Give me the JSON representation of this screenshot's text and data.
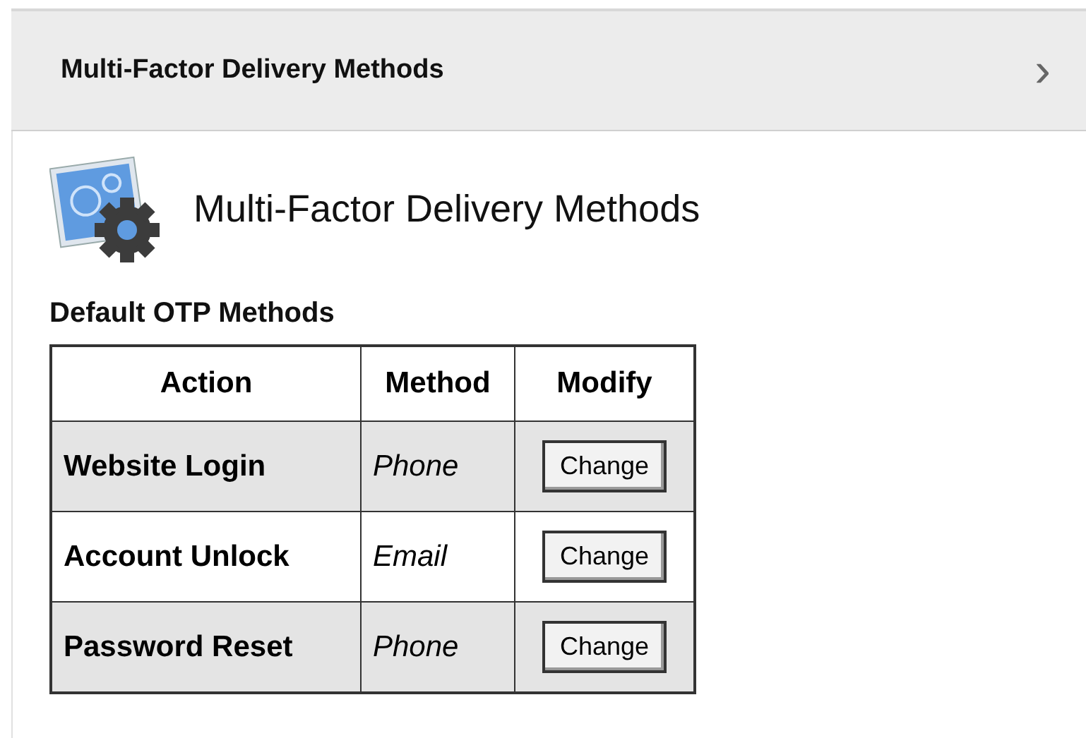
{
  "panel_header": {
    "title": "Multi-Factor Delivery Methods",
    "chevron": "›"
  },
  "page_title": "Multi-Factor Delivery Methods",
  "section_title": "Default OTP Methods",
  "table": {
    "columns": [
      "Action",
      "Method",
      "Modify"
    ],
    "rows": [
      {
        "action": "Website Login",
        "method": "Phone",
        "button": "Change",
        "shaded": true
      },
      {
        "action": "Account Unlock",
        "method": "Email",
        "button": "Change",
        "shaded": false
      },
      {
        "action": "Password Reset",
        "method": "Phone",
        "button": "Change",
        "shaded": true
      }
    ]
  }
}
